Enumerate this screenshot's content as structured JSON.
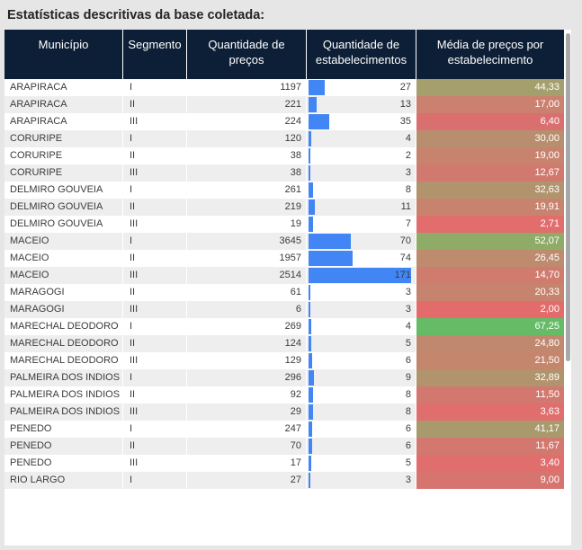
{
  "title": "Estatísticas descritivas da base coletada:",
  "headers": {
    "municipio": "Município",
    "segmento": "Segmento",
    "quantidade_precos": "Quantidade de preços",
    "quantidade_estabelecimentos": "Quantidade de estabelecimentos",
    "media_precos": "Média de preços por estabelecimento"
  },
  "bar_color": "#4286f5",
  "rows": [
    {
      "municipio": "ARAPIRACA",
      "segmento": "I",
      "precos": "1197",
      "estab": "27",
      "media": "44,33",
      "color": "#a49f6d"
    },
    {
      "municipio": "ARAPIRACA",
      "segmento": "II",
      "precos": "221",
      "estab": "13",
      "media": "17,00",
      "color": "#cc806f"
    },
    {
      "municipio": "ARAPIRACA",
      "segmento": "III",
      "precos": "224",
      "estab": "35",
      "media": "6,40",
      "color": "#d9706f"
    },
    {
      "municipio": "CORURIPE",
      "segmento": "I",
      "precos": "120",
      "estab": "4",
      "media": "30,00",
      "color": "#b78f6e"
    },
    {
      "municipio": "CORURIPE",
      "segmento": "II",
      "precos": "38",
      "estab": "2",
      "media": "19,00",
      "color": "#c8836e"
    },
    {
      "municipio": "CORURIPE",
      "segmento": "III",
      "precos": "38",
      "estab": "3",
      "media": "12,67",
      "color": "#d1796f"
    },
    {
      "municipio": "DELMIRO GOUVEIA",
      "segmento": "I",
      "precos": "261",
      "estab": "8",
      "media": "32,63",
      "color": "#b1946e"
    },
    {
      "municipio": "DELMIRO GOUVEIA",
      "segmento": "II",
      "precos": "219",
      "estab": "11",
      "media": "19,91",
      "color": "#c8836e"
    },
    {
      "municipio": "DELMIRO GOUVEIA",
      "segmento": "III",
      "precos": "19",
      "estab": "7",
      "media": "2,71",
      "color": "#e26d6d"
    },
    {
      "municipio": "MACEIO",
      "segmento": "I",
      "precos": "3645",
      "estab": "70",
      "media": "52,07",
      "color": "#8fab68"
    },
    {
      "municipio": "MACEIO",
      "segmento": "II",
      "precos": "1957",
      "estab": "74",
      "media": "26,45",
      "color": "#be8b6e"
    },
    {
      "municipio": "MACEIO",
      "segmento": "III",
      "precos": "2514",
      "estab": "171",
      "media": "14,70",
      "color": "#cf7c6f"
    },
    {
      "municipio": "MARAGOGI",
      "segmento": "II",
      "precos": "61",
      "estab": "3",
      "media": "20,33",
      "color": "#c6846e"
    },
    {
      "municipio": "MARAGOGI",
      "segmento": "III",
      "precos": "6",
      "estab": "3",
      "media": "2,00",
      "color": "#e36b6b"
    },
    {
      "municipio": "MARECHAL DEODORO",
      "segmento": "I",
      "precos": "269",
      "estab": "4",
      "media": "67,25",
      "color": "#66bb66"
    },
    {
      "municipio": "MARECHAL DEODORO",
      "segmento": "II",
      "precos": "124",
      "estab": "5",
      "media": "24,80",
      "color": "#c0886e"
    },
    {
      "municipio": "MARECHAL DEODORO",
      "segmento": "III",
      "precos": "129",
      "estab": "6",
      "media": "21,50",
      "color": "#c5866e"
    },
    {
      "municipio": "PALMEIRA DOS INDIOS",
      "segmento": "I",
      "precos": "296",
      "estab": "9",
      "media": "32,89",
      "color": "#b1946e"
    },
    {
      "municipio": "PALMEIRA DOS INDIOS",
      "segmento": "II",
      "precos": "92",
      "estab": "8",
      "media": "11,50",
      "color": "#d3786f"
    },
    {
      "municipio": "PALMEIRA DOS INDIOS",
      "segmento": "III",
      "precos": "29",
      "estab": "8",
      "media": "3,63",
      "color": "#e06e6d"
    },
    {
      "municipio": "PENEDO",
      "segmento": "I",
      "precos": "247",
      "estab": "6",
      "media": "41,17",
      "color": "#a99a6d"
    },
    {
      "municipio": "PENEDO",
      "segmento": "II",
      "precos": "70",
      "estab": "6",
      "media": "11,67",
      "color": "#d3786f"
    },
    {
      "municipio": "PENEDO",
      "segmento": "III",
      "precos": "17",
      "estab": "5",
      "media": "3,40",
      "color": "#e06e6d"
    },
    {
      "municipio": "RIO LARGO",
      "segmento": "I",
      "precos": "27",
      "estab": "3",
      "media": "9,00",
      "color": "#d6746f"
    }
  ]
}
